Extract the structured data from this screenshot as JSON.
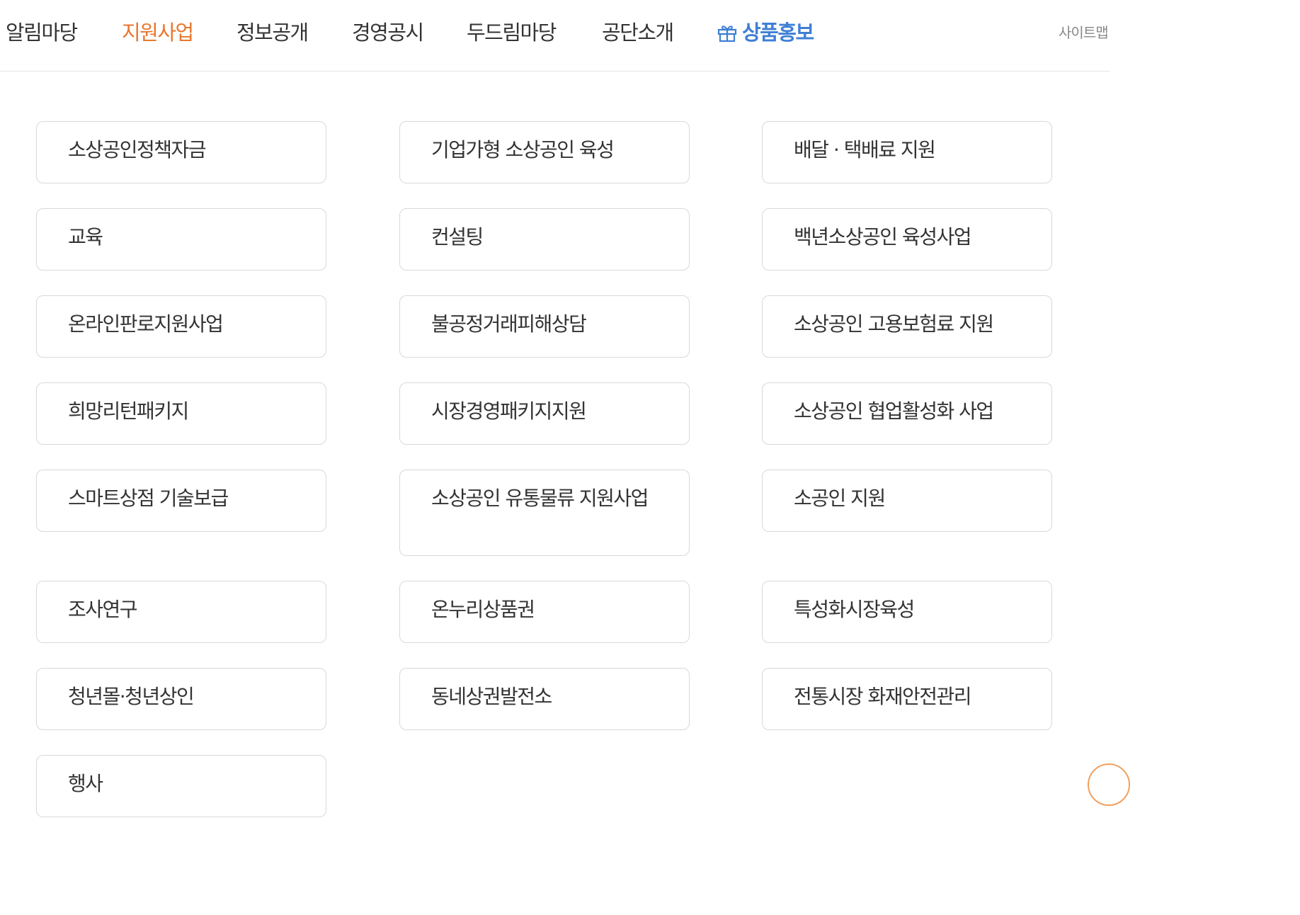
{
  "nav": {
    "items": [
      "알림마당",
      "지원사업",
      "정보공개",
      "경영공시",
      "두드림마당",
      "공단소개"
    ],
    "active_index": 1,
    "promo_label": "상품홍보",
    "sitemap_label": "사이트맵"
  },
  "menu": [
    "소상공인정책자금",
    "기업가형 소상공인 육성",
    "배달 · 택배료 지원",
    "교육",
    "컨설팅",
    "백년소상공인 육성사업",
    "온라인판로지원사업",
    "불공정거래피해상담",
    "소상공인 고용보험료 지원",
    "희망리턴패키지",
    "시장경영패키지지원",
    "소상공인 협업활성화 사업",
    "스마트상점 기술보급",
    "소상공인 유통물류 지원사업",
    "소공인 지원",
    "조사연구",
    "온누리상품권",
    "특성화시장육성",
    "청년몰·청년상인",
    "동네상권발전소",
    "전통시장 화재안전관리",
    "행사"
  ],
  "colors": {
    "active": "#e8772e",
    "promo": "#3f7fd4",
    "border": "#d9d9d9"
  }
}
